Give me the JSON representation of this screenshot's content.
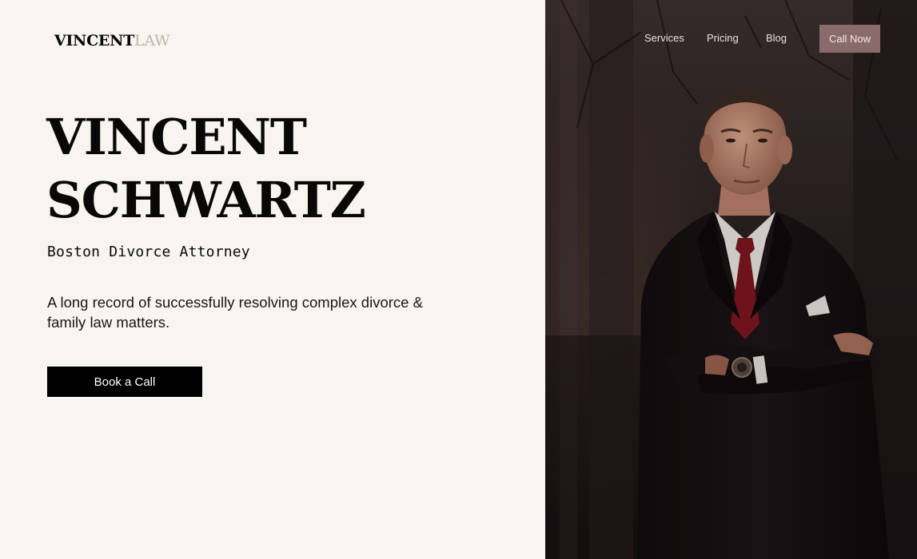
{
  "brand": {
    "logo_part1": "VINCENT",
    "logo_part2": "LAW"
  },
  "nav": {
    "items": [
      {
        "label": "Services"
      },
      {
        "label": "Pricing"
      },
      {
        "label": "Blog"
      }
    ],
    "cta_label": "Call Now"
  },
  "hero": {
    "title_line1": "VINCENT",
    "title_line2": "SCHWARTZ",
    "subtitle": "Boston Divorce Attorney",
    "description": "A long record of successfully resolving complex divorce & family law matters.",
    "button_label": "Book a Call"
  },
  "colors": {
    "page_background": "#f8f4ef",
    "primary_text": "#0a0807",
    "logo_muted": "#bfb6b0",
    "button_primary": "#000000",
    "button_accent": "#8a6b6b"
  }
}
